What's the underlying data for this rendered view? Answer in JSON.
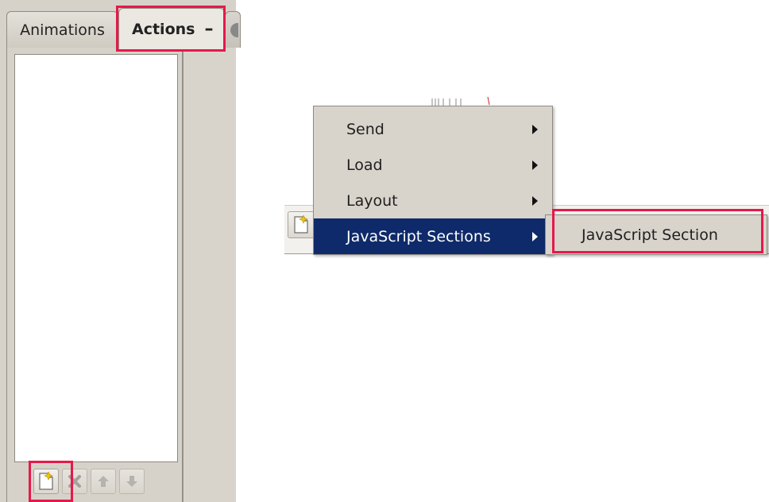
{
  "tabs": {
    "animations": "Animations",
    "actions": "Actions",
    "actions_close": "–"
  },
  "toolbar": {
    "buttons": [
      {
        "icon": "new-item-icon",
        "enabled": true
      },
      {
        "icon": "delete-icon",
        "enabled": false
      },
      {
        "icon": "move-up-icon",
        "enabled": false
      },
      {
        "icon": "move-down-icon",
        "enabled": false
      }
    ]
  },
  "menu": {
    "items": [
      {
        "label": "Send",
        "has_submenu": true,
        "selected": false
      },
      {
        "label": "Load",
        "has_submenu": true,
        "selected": false
      },
      {
        "label": "Layout",
        "has_submenu": true,
        "selected": false
      },
      {
        "label": "JavaScript Sections",
        "has_submenu": true,
        "selected": true
      }
    ]
  },
  "submenu": {
    "items": [
      {
        "label": "JavaScript Section"
      }
    ]
  },
  "colors": {
    "highlight": "#e6184a",
    "menu_selected_bg": "#0e2a6a",
    "panel_bg": "#d6d2ca"
  }
}
